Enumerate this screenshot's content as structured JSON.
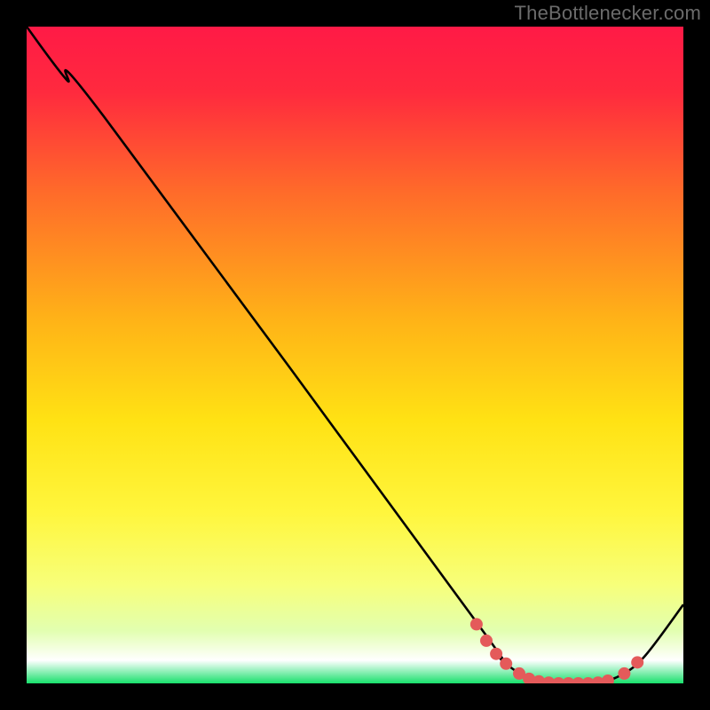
{
  "watermark": "TheBottlenecker.com",
  "chart_data": {
    "type": "line",
    "title": "",
    "xlabel": "",
    "ylabel": "",
    "xlim": [
      0,
      100
    ],
    "ylim": [
      0,
      100
    ],
    "gradient_stops": [
      {
        "offset": 0.0,
        "color": "#ff1a46"
      },
      {
        "offset": 0.1,
        "color": "#ff2a3e"
      },
      {
        "offset": 0.25,
        "color": "#ff6a2a"
      },
      {
        "offset": 0.45,
        "color": "#ffb417"
      },
      {
        "offset": 0.6,
        "color": "#ffe214"
      },
      {
        "offset": 0.74,
        "color": "#fff63d"
      },
      {
        "offset": 0.85,
        "color": "#f7ff7a"
      },
      {
        "offset": 0.92,
        "color": "#e2ffb0"
      },
      {
        "offset": 0.965,
        "color": "#ffffff"
      },
      {
        "offset": 1.0,
        "color": "#18e06c"
      }
    ],
    "series": [
      {
        "name": "bottleneck-curve",
        "color": "#000000",
        "points": [
          {
            "x": 0,
            "y": 100
          },
          {
            "x": 6,
            "y": 92
          },
          {
            "x": 12,
            "y": 86
          },
          {
            "x": 68,
            "y": 10
          },
          {
            "x": 72,
            "y": 4
          },
          {
            "x": 76,
            "y": 1
          },
          {
            "x": 80,
            "y": 0
          },
          {
            "x": 86,
            "y": 0
          },
          {
            "x": 90,
            "y": 1
          },
          {
            "x": 94,
            "y": 4
          },
          {
            "x": 100,
            "y": 12
          }
        ]
      }
    ],
    "markers": {
      "color": "#e45a5a",
      "radius": 7,
      "points": [
        {
          "x": 68.5,
          "y": 9
        },
        {
          "x": 70,
          "y": 6.5
        },
        {
          "x": 71.5,
          "y": 4.5
        },
        {
          "x": 73,
          "y": 3
        },
        {
          "x": 75,
          "y": 1.5
        },
        {
          "x": 76.5,
          "y": 0.7
        },
        {
          "x": 78,
          "y": 0.3
        },
        {
          "x": 79.5,
          "y": 0.1
        },
        {
          "x": 81,
          "y": 0
        },
        {
          "x": 82.5,
          "y": 0
        },
        {
          "x": 84,
          "y": 0
        },
        {
          "x": 85.5,
          "y": 0
        },
        {
          "x": 87,
          "y": 0.1
        },
        {
          "x": 88.5,
          "y": 0.4
        },
        {
          "x": 91,
          "y": 1.5
        },
        {
          "x": 93,
          "y": 3.2
        }
      ]
    }
  }
}
